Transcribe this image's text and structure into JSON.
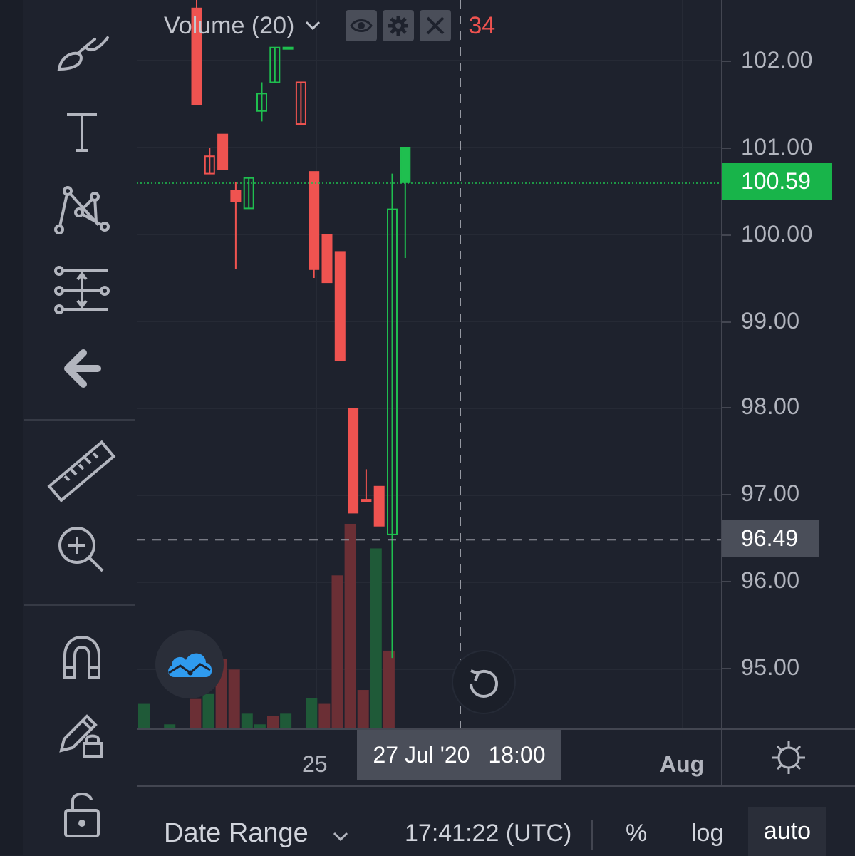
{
  "legend": {
    "indicator_name": "Volume (20)",
    "value": "34",
    "buttons": [
      "eye-icon",
      "gear-icon",
      "close-icon"
    ]
  },
  "price_axis": {
    "ticks": [
      "102.00",
      "101.00",
      "100.00",
      "99.00",
      "98.00",
      "97.00",
      "96.00",
      "95.00"
    ],
    "last_price": "100.59",
    "crosshair_price": "96.49"
  },
  "time_axis": {
    "ticks": [
      "25",
      "Aug"
    ],
    "crosshair_date": "27 Jul '20",
    "crosshair_time": "18:00"
  },
  "bottom_bar": {
    "date_range_label": "Date Range",
    "clock": "17:41:22 (UTC)",
    "percent_label": "%",
    "log_label": "log",
    "auto_label": "auto"
  },
  "toolbar": {
    "tools": [
      "brush-icon",
      "text-icon",
      "pattern-icon",
      "measure-lines-icon",
      "back-arrow-icon",
      "ruler-icon",
      "zoom-in-icon",
      "magnet-icon",
      "pencil-lock-icon",
      "unlock-icon"
    ]
  },
  "colors": {
    "up": "#26a69a",
    "up_candle": "#1fbf4f",
    "down": "#ef5350",
    "background": "#1e222d",
    "last_price_bg": "#18b44a"
  },
  "chart_data": {
    "type": "candlestick",
    "y_range": [
      94.3,
      102.7
    ],
    "note_series": "price candles (OHLC) with volume histogram overlay",
    "candles": [
      {
        "o": 102.6,
        "h": 102.7,
        "l": 101.5,
        "c": 101.5,
        "dir": "down",
        "hollow": false
      },
      {
        "o": 100.9,
        "h": 101.0,
        "l": 100.7,
        "c": 100.7,
        "dir": "down",
        "hollow": true
      },
      {
        "o": 101.15,
        "h": 101.15,
        "l": 100.75,
        "c": 100.75,
        "dir": "down",
        "hollow": false
      },
      {
        "o": 100.5,
        "h": 100.6,
        "l": 99.6,
        "c": 100.38,
        "dir": "down",
        "hollow": false
      },
      {
        "o": 100.3,
        "h": 100.65,
        "l": 100.3,
        "c": 100.65,
        "dir": "up",
        "hollow": true
      },
      {
        "o": 101.42,
        "h": 101.75,
        "l": 101.3,
        "c": 101.62,
        "dir": "up",
        "hollow": true
      },
      {
        "o": 101.75,
        "h": 102.15,
        "l": 101.75,
        "c": 102.15,
        "dir": "up",
        "hollow": true
      },
      {
        "o": 102.15,
        "h": 102.15,
        "l": 102.15,
        "c": 102.15,
        "dir": "up",
        "hollow": true
      },
      {
        "o": 101.75,
        "h": 101.75,
        "l": 101.27,
        "c": 101.27,
        "dir": "down",
        "hollow": true
      },
      {
        "o": 100.72,
        "h": 100.72,
        "l": 99.5,
        "c": 99.6,
        "dir": "down",
        "hollow": false
      },
      {
        "o": 100.0,
        "h": 100.0,
        "l": 99.45,
        "c": 99.45,
        "dir": "down",
        "hollow": false
      },
      {
        "o": 99.8,
        "h": 99.8,
        "l": 98.55,
        "c": 98.55,
        "dir": "down",
        "hollow": false
      },
      {
        "o": 98.0,
        "h": 98.0,
        "l": 96.8,
        "c": 96.8,
        "dir": "down",
        "hollow": false
      },
      {
        "o": 96.95,
        "h": 97.3,
        "l": 96.95,
        "c": 96.95,
        "dir": "down",
        "hollow": false
      },
      {
        "o": 97.1,
        "h": 97.1,
        "l": 96.65,
        "c": 96.65,
        "dir": "down",
        "hollow": false
      },
      {
        "o": 96.55,
        "h": 100.7,
        "l": 95.13,
        "c": 100.29,
        "dir": "up",
        "hollow": true
      },
      {
        "o": 100.6,
        "h": 101.0,
        "l": 99.73,
        "c": 101.0,
        "dir": "up",
        "hollow": false
      }
    ],
    "volume_series": [
      {
        "v": 30,
        "dir": "up"
      },
      {
        "v": 0,
        "dir": "none"
      },
      {
        "v": 5,
        "dir": "up"
      },
      {
        "v": 0,
        "dir": "none"
      },
      {
        "v": 36,
        "dir": "down"
      },
      {
        "v": 42,
        "dir": "up"
      },
      {
        "v": 85,
        "dir": "down"
      },
      {
        "v": 72,
        "dir": "down"
      },
      {
        "v": 18,
        "dir": "up"
      },
      {
        "v": 5,
        "dir": "up"
      },
      {
        "v": 15,
        "dir": "down"
      },
      {
        "v": 18,
        "dir": "up"
      },
      {
        "v": 0,
        "dir": "none"
      },
      {
        "v": 37,
        "dir": "up"
      },
      {
        "v": 30,
        "dir": "down"
      },
      {
        "v": 187,
        "dir": "down"
      },
      {
        "v": 250,
        "dir": "down"
      },
      {
        "v": 47,
        "dir": "down"
      },
      {
        "v": 220,
        "dir": "up"
      },
      {
        "v": 95,
        "dir": "down"
      }
    ],
    "volume_max": 270,
    "crosshair": {
      "price": 96.49,
      "date": "27 Jul '20 18:00"
    },
    "last_price": 100.59
  }
}
